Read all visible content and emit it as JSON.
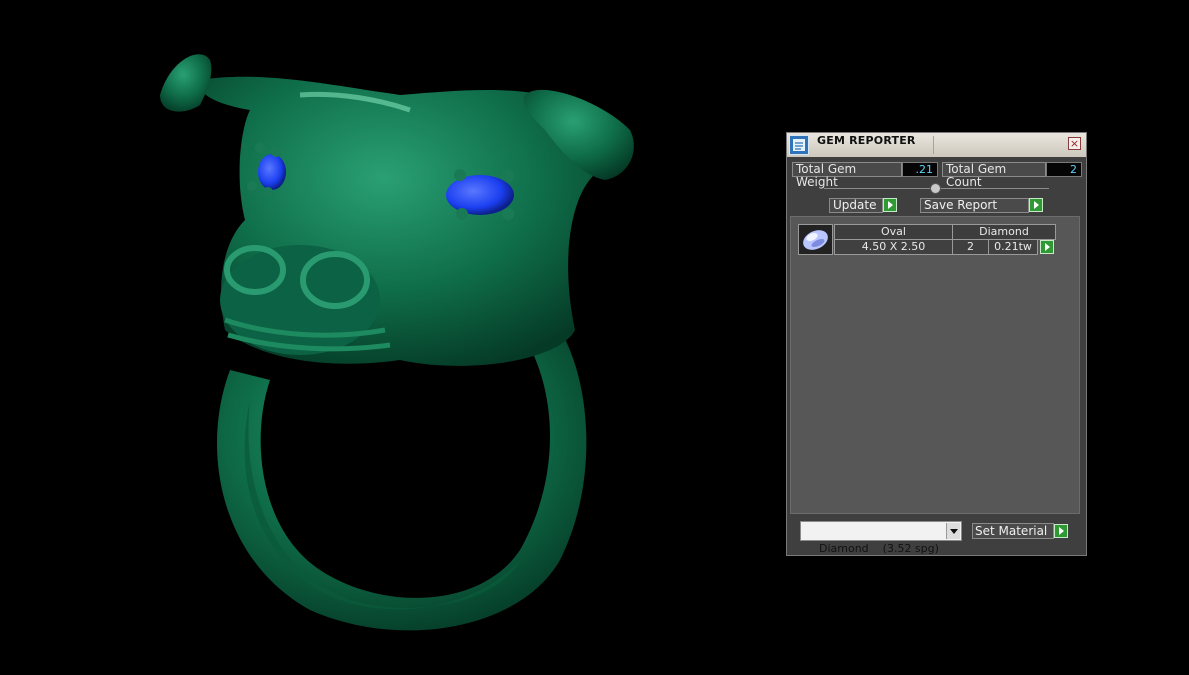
{
  "viewport": {
    "model": "green ring with bull head sculpture",
    "model_color": "#0f6e4a",
    "gem_color": "#1b3ff0",
    "background_color": "#000000"
  },
  "panel": {
    "title": "GEM REPORTER",
    "icon": "gem-reporter-icon",
    "close_icon": "close-icon",
    "total_gem_weight_label": "Total Gem Weight",
    "total_gem_weight_value": ".21",
    "total_gem_count_label": "Total Gem Count",
    "total_gem_count_value": "2",
    "update_label": "Update",
    "save_report_label": "Save Report",
    "list": {
      "rows": [
        {
          "thumb_icon": "oval-gem-icon",
          "shape": "Oval",
          "material": "Diamond",
          "size": "4.50 X 2.50",
          "count": "2",
          "weight": "0.21tw"
        }
      ]
    },
    "material_select": {
      "selected": "Diamond    (3.52 spg)"
    },
    "set_material_label": "Set Material"
  },
  "colors": {
    "panel_bg": "#3f3f3f",
    "list_bg": "#575757",
    "value_text": "#59d2ff",
    "go_green": "#2f9a34"
  }
}
